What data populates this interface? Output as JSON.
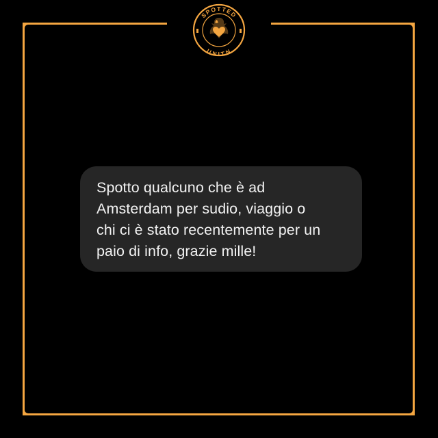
{
  "colors": {
    "background": "#000000",
    "accent": "#f4a641",
    "bubble": "#262626",
    "text": "#f2f2f2"
  },
  "logo": {
    "icon": "spotted-unitn-eagle-heart-logo",
    "text_top": "SPOTTED",
    "text_bottom": "UNITN"
  },
  "message": {
    "lines": [
      "Spotto qualcuno che è ad",
      "Amsterdam per sudio, viaggio o",
      "chi ci è stato recentemente per un",
      "paio di info, grazie mille!"
    ]
  }
}
